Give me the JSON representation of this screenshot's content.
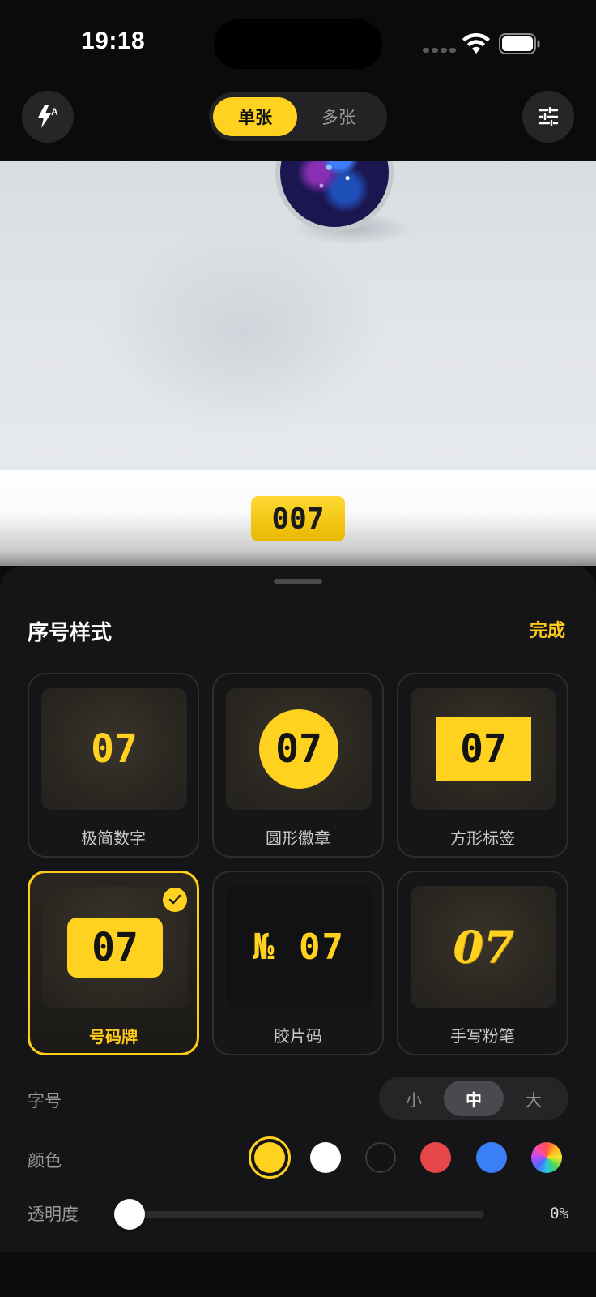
{
  "status_bar": {
    "time": "19:18"
  },
  "top_bar": {
    "flash_icon": "flash-auto-icon",
    "adjust_icon": "sliders-icon",
    "modes": [
      "单张",
      "多张"
    ],
    "selected_mode": "单张"
  },
  "preview": {
    "tag_text": "007"
  },
  "sheet": {
    "title": "序号样式",
    "done_label": "完成",
    "styles": [
      {
        "label": "极简数字",
        "sample": "07",
        "selected": false
      },
      {
        "label": "圆形徽章",
        "sample": "07",
        "selected": false
      },
      {
        "label": "方形标签",
        "sample": "07",
        "selected": false
      },
      {
        "label": "号码牌",
        "sample": "07",
        "selected": true
      },
      {
        "label": "胶片码",
        "sample": "№ 07",
        "selected": false
      },
      {
        "label": "手写粉笔",
        "sample": "07",
        "selected": false
      }
    ],
    "font_size": {
      "label": "字号",
      "options": [
        "小",
        "中",
        "大"
      ],
      "selected": "中"
    },
    "color": {
      "label": "颜色",
      "swatches": [
        "#ffd21f",
        "#ffffff",
        "#141414",
        "#e5474b",
        "#3a7ff5",
        "rainbow"
      ],
      "selected": "#ffd21f"
    },
    "opacity": {
      "label": "透明度",
      "value": "0%",
      "fraction": 0
    }
  }
}
